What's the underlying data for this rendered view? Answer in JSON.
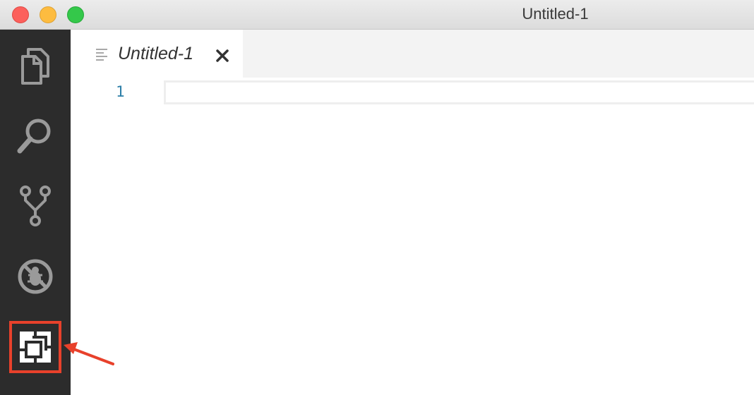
{
  "window": {
    "title": "Untitled-1",
    "traffic_lights": [
      "close",
      "minimize",
      "maximize"
    ]
  },
  "activity_bar": {
    "items": [
      {
        "id": "explorer",
        "icon": "files-icon",
        "active": false
      },
      {
        "id": "search",
        "icon": "search-icon",
        "active": false
      },
      {
        "id": "source-control",
        "icon": "git-branch-icon",
        "active": false
      },
      {
        "id": "debug",
        "icon": "debug-icon",
        "active": false
      },
      {
        "id": "extensions",
        "icon": "extensions-icon",
        "active": true,
        "highlighted": true
      }
    ]
  },
  "tabs": [
    {
      "label": "Untitled-1",
      "icon": "file-lines-icon",
      "close_icon": "close-icon",
      "preview": true
    }
  ],
  "editor": {
    "line_numbers": [
      "1"
    ]
  },
  "colors": {
    "activity_bar_bg": "#2c2c2c",
    "highlight": "#e8412b",
    "line_number": "#2d7fa8"
  }
}
